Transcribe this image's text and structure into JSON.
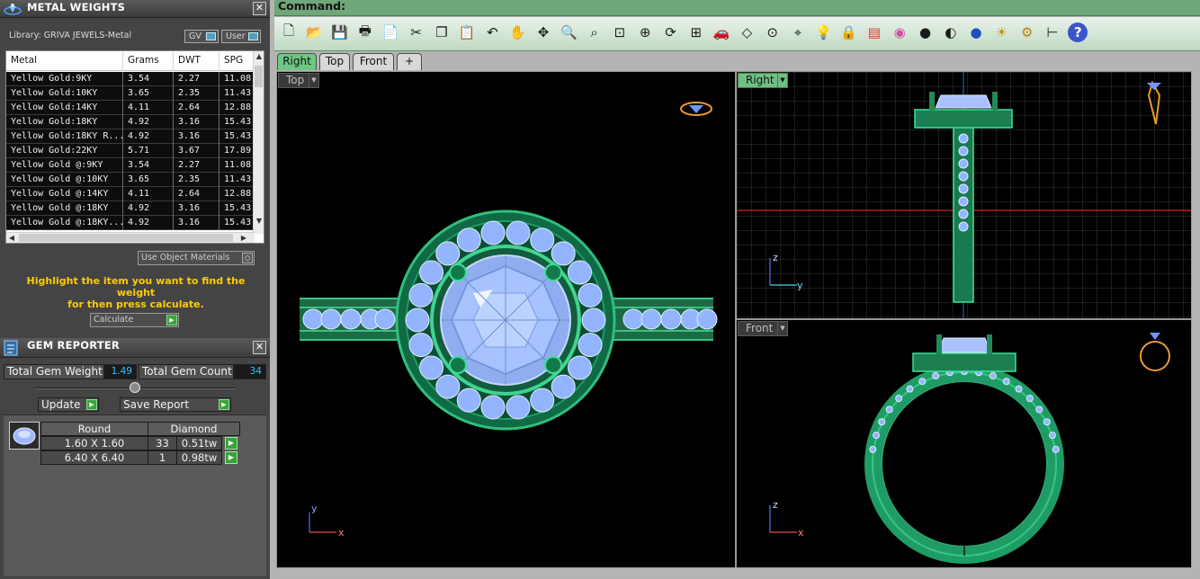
{
  "metal_weights": {
    "title": "METAL WEIGHTS",
    "library": "Library: GRIVA JEWELS-Metal",
    "toggle_gv": "GV",
    "toggle_user": "User",
    "columns": [
      "Metal",
      "Grams",
      "DWT",
      "SPG"
    ],
    "rows": [
      [
        "Yellow Gold:9KY",
        "3.54",
        "2.27",
        "11.08"
      ],
      [
        "Yellow Gold:10KY",
        "3.65",
        "2.35",
        "11.43"
      ],
      [
        "Yellow Gold:14KY",
        "4.11",
        "2.64",
        "12.88"
      ],
      [
        "Yellow Gold:18KY",
        "4.92",
        "3.16",
        "15.43"
      ],
      [
        "Yellow Gold:18KY R...",
        "4.92",
        "3.16",
        "15.43"
      ],
      [
        "Yellow Gold:22KY",
        "5.71",
        "3.67",
        "17.89"
      ],
      [
        "Yellow Gold @:9KY",
        "3.54",
        "2.27",
        "11.08"
      ],
      [
        "Yellow Gold @:10KY",
        "3.65",
        "2.35",
        "11.43"
      ],
      [
        "Yellow Gold @:14KY",
        "4.11",
        "2.64",
        "12.88"
      ],
      [
        "Yellow Gold @:18KY",
        "4.92",
        "3.16",
        "15.43"
      ],
      [
        "Yellow Gold @:18KY...",
        "4.92",
        "3.16",
        "15.43"
      ]
    ],
    "use_object_materials": "Use Object Materials",
    "hint_line1": "Highlight the item you want to find the weight",
    "hint_line2": "for then press calculate.",
    "calculate": "Calculate"
  },
  "gem_reporter": {
    "title": "GEM REPORTER",
    "total_weight_label": "Total Gem Weight",
    "total_weight_value": "1.49",
    "total_count_label": "Total Gem Count",
    "total_count_value": "34",
    "update": "Update",
    "save_report": "Save Report",
    "shape": "Round",
    "type": "Diamond",
    "rows": [
      {
        "size": "1.60 X 1.60",
        "count": "33",
        "weight": "0.51tw"
      },
      {
        "size": "6.40 X 6.40",
        "count": "1",
        "weight": "0.98tw"
      }
    ]
  },
  "command": {
    "label": "Command:"
  },
  "toolbar_icons": [
    "new-file-icon",
    "open-folder-icon",
    "save-icon",
    "print-icon",
    "properties-icon",
    "cut-icon",
    "copy-icon",
    "paste-icon",
    "undo-icon",
    "pan-hand-icon",
    "rotate-view-icon",
    "zoom-icon",
    "zoom-window-icon",
    "zoom-extents-icon",
    "zoom-selected-icon",
    "rotate-icon",
    "four-viewports-icon",
    "car-icon",
    "plane-icon",
    "snap-icon",
    "gumball-icon",
    "light-bulb-icon",
    "lock-icon",
    "layers-icon",
    "color-wheel-icon",
    "shaded-sphere-icon",
    "rendered-sphere-icon",
    "blue-sphere-icon",
    "lamp-icon",
    "settings-gear-icon",
    "dimension-icon",
    "help-icon"
  ],
  "view_tabs": [
    "Right",
    "Top",
    "Front",
    "+"
  ],
  "viewports": {
    "top": {
      "label": "Top",
      "axis_x": "x",
      "axis_y": "y"
    },
    "right": {
      "label": "Right",
      "axis_z": "z",
      "axis_y": "y"
    },
    "front": {
      "label": "Front",
      "axis_z": "z",
      "axis_x": "x"
    }
  },
  "colors": {
    "metal_green": "#1e8a5a",
    "gem_blue": "#8fb4ff",
    "accent_green": "#6ec783",
    "hint_yellow": "#ffcc00",
    "value_cyan": "#2ac7ff"
  }
}
